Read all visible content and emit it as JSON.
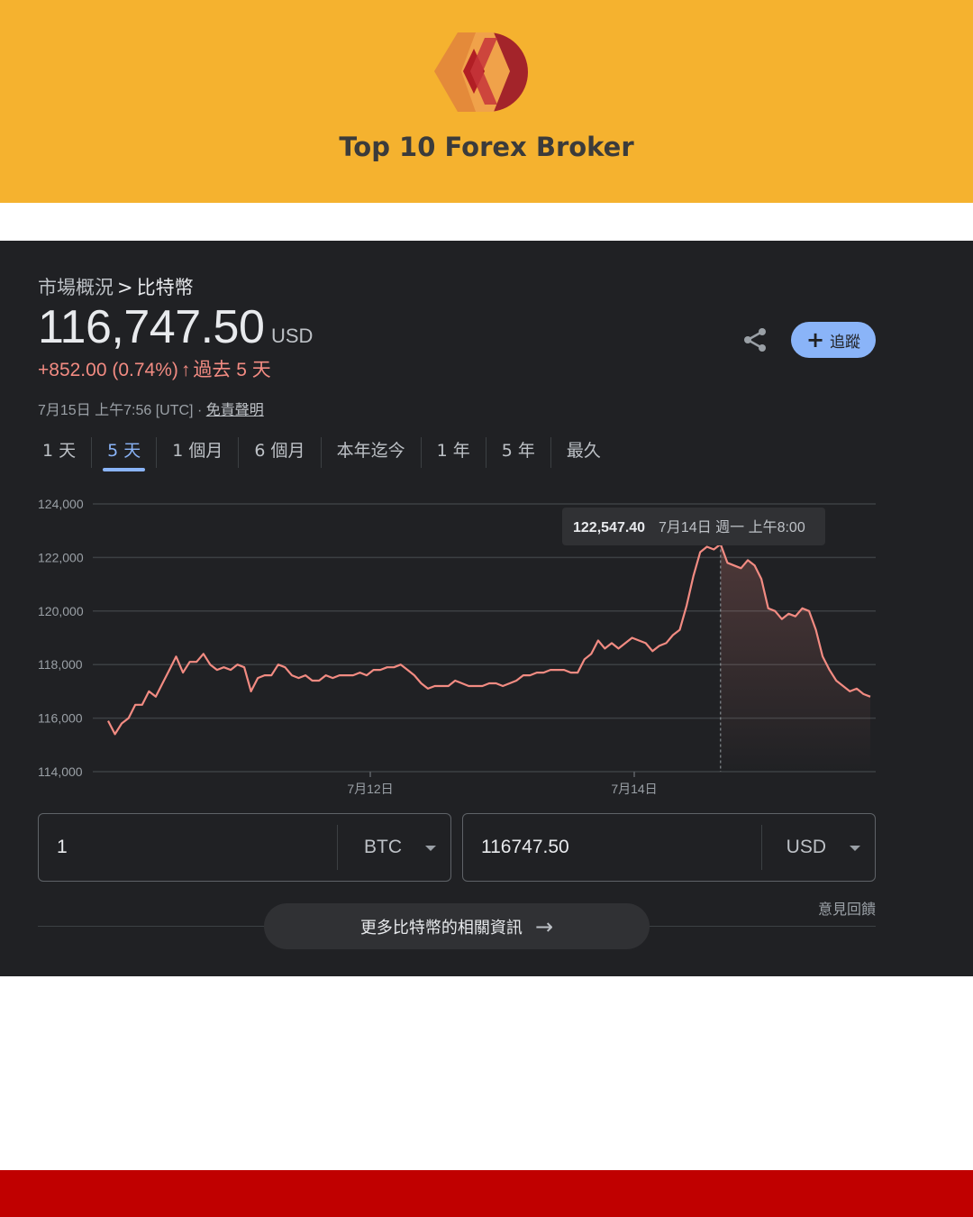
{
  "banner": {
    "brand": "Top 10 Forex Broker",
    "logo": "diamond-d-logo",
    "bg_color": "#f5b22f"
  },
  "breadcrumb": {
    "parent": "市場概況",
    "separator": ">",
    "current": "比特幣"
  },
  "quote": {
    "price": "116,747.50",
    "unit": "USD",
    "change": "+852.00 (0.74%)",
    "arrow": "↑",
    "period": "過去 5 天",
    "timestamp": "7月15日 上午7:56 [UTC] · ",
    "disclaimer": "免責聲明",
    "up_color": "#f28b82"
  },
  "actions": {
    "share_icon": "share-icon",
    "follow_label": "追蹤",
    "follow_icon": "+"
  },
  "tabs": [
    "1 天",
    "5 天",
    "1 個月",
    "6 個月",
    "本年迄今",
    "1 年",
    "5 年",
    "最久"
  ],
  "active_tab": "5 天",
  "chart_data": {
    "type": "line",
    "x_ticks": [
      "7月12日",
      "7月14日"
    ],
    "y_ticks": [
      "124,000",
      "122,000",
      "120,000",
      "118,000",
      "116,000",
      "114,000"
    ],
    "ylim": [
      114000,
      124000
    ],
    "grid": true,
    "series": [
      {
        "values": [
          115900,
          115400,
          115800,
          116000,
          116500,
          116500,
          117000,
          116800,
          117300,
          117800,
          118300,
          117700,
          118100,
          118100,
          118400,
          118000,
          117800,
          117900,
          117800,
          118000,
          117900,
          117000,
          117500,
          117600,
          117600,
          118000,
          117900,
          117600,
          117500,
          117600,
          117400,
          117400,
          117600,
          117500,
          117600,
          117600,
          117600,
          117700,
          117600,
          117800,
          117800,
          117900,
          117900,
          118000,
          117800,
          117600,
          117300,
          117100,
          117200,
          117200,
          117200,
          117400,
          117300,
          117200,
          117200,
          117200,
          117300,
          117300,
          117200,
          117300,
          117400,
          117600,
          117600,
          117700,
          117700,
          117800,
          117800,
          117800,
          117700,
          117700,
          118200,
          118400,
          118900,
          118600,
          118800,
          118600,
          118800,
          119000,
          118900,
          118800,
          118500,
          118700,
          118800,
          119100,
          119300,
          120200,
          121300,
          122200,
          122400,
          122300,
          122500,
          121800,
          121700,
          121600,
          121900,
          121700,
          121200,
          120100,
          120000,
          119700,
          119900,
          119800,
          120100,
          120000,
          119300,
          118300,
          117800,
          117400,
          117200,
          117000,
          117100,
          116900,
          116800
        ]
      }
    ],
    "tooltip": {
      "value": "122,547.40",
      "date": "7月14日 週一 上午8:00"
    },
    "line_color": "#f28b82"
  },
  "converter": {
    "from": {
      "amount": "1",
      "currency": "BTC"
    },
    "to": {
      "amount": "116747.50",
      "currency": "USD"
    }
  },
  "feedback": "意見回饋",
  "more_info": {
    "label": "更多比特幣的相關資訊",
    "arrow": "→"
  }
}
